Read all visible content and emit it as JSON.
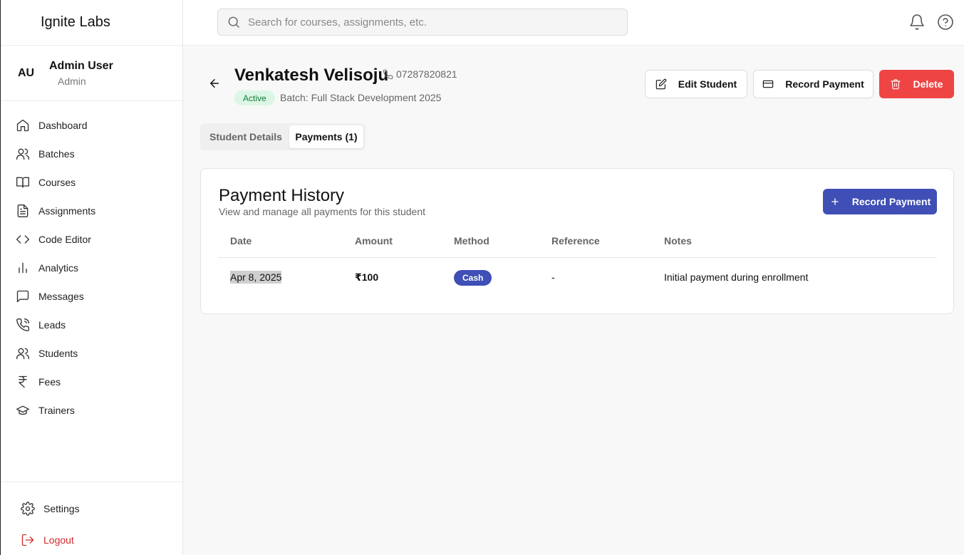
{
  "app": {
    "brand": "Ignite Labs"
  },
  "user": {
    "initials": "AU",
    "name": "Admin User",
    "role": "Admin"
  },
  "sidebar": {
    "items": [
      {
        "label": "Dashboard",
        "icon": "home-icon"
      },
      {
        "label": "Batches",
        "icon": "users-icon"
      },
      {
        "label": "Courses",
        "icon": "book-icon"
      },
      {
        "label": "Assignments",
        "icon": "file-text-icon"
      },
      {
        "label": "Code Editor",
        "icon": "code-icon"
      },
      {
        "label": "Analytics",
        "icon": "bar-chart-icon"
      },
      {
        "label": "Messages",
        "icon": "message-square-icon"
      },
      {
        "label": "Leads",
        "icon": "phone-call-icon"
      },
      {
        "label": "Students",
        "icon": "users-icon"
      },
      {
        "label": "Fees",
        "icon": "rupee-icon"
      },
      {
        "label": "Trainers",
        "icon": "graduation-cap-icon"
      }
    ],
    "settings": "Settings",
    "logout": "Logout"
  },
  "search": {
    "placeholder": "Search for courses, assignments, etc."
  },
  "student": {
    "name": "Venkatesh Velisoju",
    "phone": "07287820821",
    "status": "Active",
    "batch": "Batch: Full Stack Development 2025"
  },
  "actions": {
    "edit": "Edit Student",
    "record_payment": "Record Payment",
    "delete": "Delete"
  },
  "tabs": [
    {
      "label": "Student Details",
      "active": false
    },
    {
      "label": "Payments (1)",
      "active": true
    }
  ],
  "payments": {
    "title": "Payment History",
    "subtitle": "View and manage all payments for this student",
    "record_button": "Record Payment",
    "columns": [
      "Date",
      "Amount",
      "Method",
      "Reference",
      "Notes"
    ],
    "rows": [
      {
        "date": "Apr 8, 2025",
        "amount": "₹100",
        "method": "Cash",
        "reference": "-",
        "notes": "Initial payment during enrollment"
      }
    ]
  },
  "colors": {
    "primary": "#3f4fb5",
    "danger": "#ef4444",
    "active_badge_bg": "#dcf6e5",
    "logout": "#d12b2b"
  }
}
